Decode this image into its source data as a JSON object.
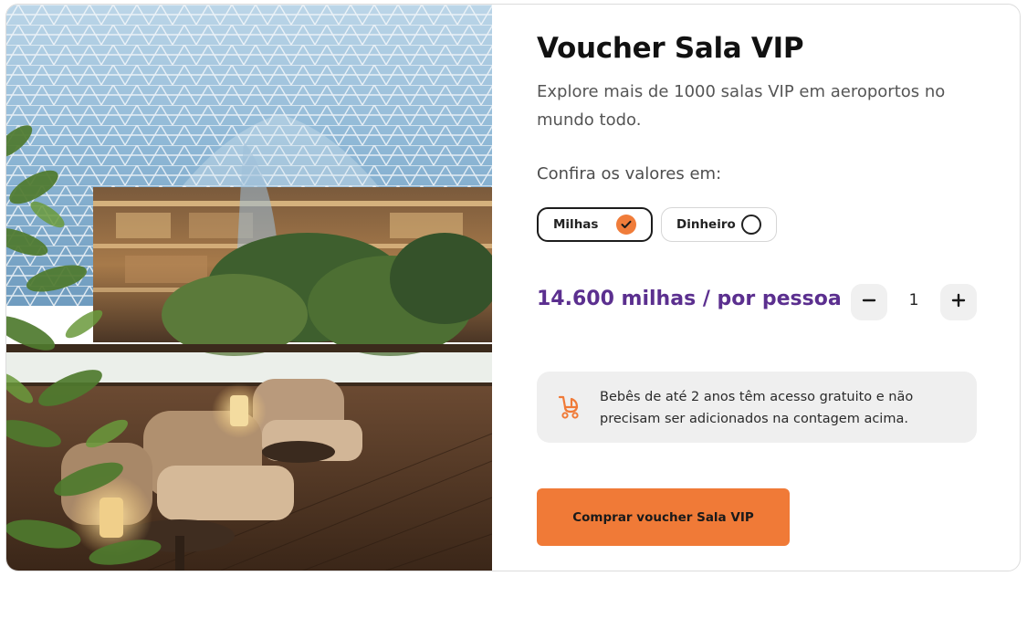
{
  "product": {
    "title": "Voucher Sala VIP",
    "description": "Explore mais de 1000 salas VIP em aeroportos no mundo todo.",
    "prices_label": "Confira os valores em:"
  },
  "payment_options": [
    {
      "label": "Milhas",
      "selected": true
    },
    {
      "label": "Dinheiro",
      "selected": false
    }
  ],
  "price": {
    "text": "14.600 milhas / por pessoa"
  },
  "quantity": {
    "value": "1"
  },
  "info": {
    "text": "Bebês de até 2 anos têm acesso gratuito e não precisam ser adicionados na contagem acima."
  },
  "cta": {
    "label": "Comprar voucher Sala VIP"
  },
  "colors": {
    "accent": "#f07a37",
    "price": "#5b2f8f"
  },
  "icons": {
    "selected": "check-icon",
    "unselected": "radio-empty-icon",
    "decrement": "minus-icon",
    "increment": "plus-icon",
    "info": "baby-stroller-icon"
  }
}
